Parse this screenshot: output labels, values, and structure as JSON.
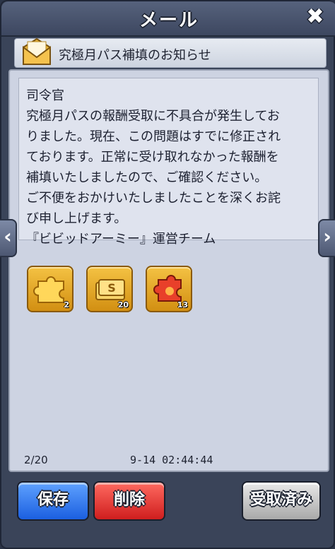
{
  "window": {
    "title": "メール",
    "close_glyph": "✖"
  },
  "subject": {
    "icon": "envelope-icon",
    "text": "究極月パス補填のお知らせ"
  },
  "message": {
    "lines": [
      "司令官",
      "究極月パスの報酬受取に不具合が発生してお",
      "りました。現在、この問題はすでに修正され",
      "ております。正常に受け取れなかった報酬を",
      "補填いたしましたので、ご確認ください。",
      "ご不便をおかけいたしましたことを深くお詫",
      "び申し上げます。",
      "『ビビッドアーミー』運営チーム"
    ]
  },
  "rewards": [
    {
      "icon": "puzzle-piece-icon",
      "count": "2"
    },
    {
      "icon": "silver-ticket-icon",
      "count": "20"
    },
    {
      "icon": "red-puzzle-piece-icon",
      "count": "13"
    }
  ],
  "footer": {
    "page": "2/20",
    "date": "9-14 02:44:44"
  },
  "nav": {
    "prev_glyph": "‹",
    "next_glyph": "›"
  },
  "buttons": {
    "save": "保存",
    "delete": "削除",
    "received": "受取済み"
  },
  "colors": {
    "save": "#1b5fe0",
    "delete": "#cf1e1e",
    "received": "#a9a9a9",
    "reward_gold": "#d28f12"
  }
}
